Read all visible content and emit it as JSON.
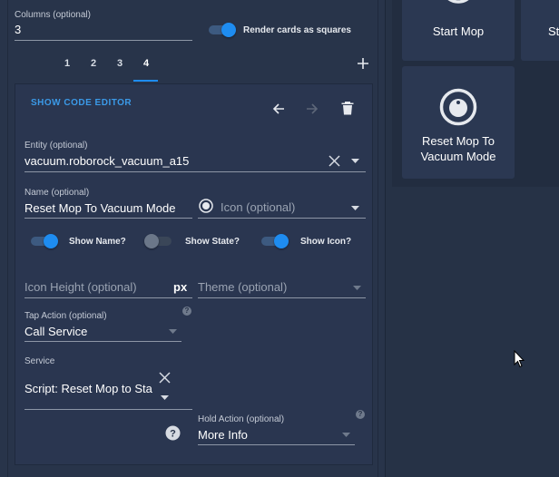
{
  "columns": {
    "label": "Columns (optional)",
    "value": "3"
  },
  "render_squares": {
    "label": "Render cards as squares",
    "on": true
  },
  "tabs": [
    {
      "label": "1"
    },
    {
      "label": "2"
    },
    {
      "label": "3"
    },
    {
      "label": "4"
    }
  ],
  "active_tab": "4",
  "card": {
    "code_editor_label": "SHOW CODE EDITOR",
    "entity": {
      "label": "Entity (optional)",
      "value": "vacuum.roborock_vacuum_a15"
    },
    "name": {
      "label": "Name (optional)",
      "value": "Reset Mop To Vacuum Mode"
    },
    "icon": {
      "placeholder": "Icon (optional)"
    },
    "show_name": {
      "label": "Show Name?",
      "on": true
    },
    "show_state": {
      "label": "Show State?",
      "on": false
    },
    "show_icon": {
      "label": "Show Icon?",
      "on": true
    },
    "icon_height": {
      "placeholder": "Icon Height (optional)",
      "suffix": "px"
    },
    "theme": {
      "placeholder": "Theme (optional)"
    },
    "tap_action": {
      "label": "Tap Action (optional)",
      "value": "Call Service"
    },
    "service": {
      "label": "Service",
      "value": "Script: Reset Mop to Sta"
    },
    "hold_action": {
      "label": "Hold Action (optional)",
      "value": "More Info"
    }
  },
  "preview": {
    "tiles": [
      {
        "label": "Start Mop"
      },
      {
        "label": "St"
      },
      {
        "label_line1": "Reset Mop To",
        "label_line2": "Vacuum Mode"
      }
    ]
  },
  "colors": {
    "accent": "#1e8cf0",
    "link": "#3b9ae8",
    "background": "#263246"
  }
}
